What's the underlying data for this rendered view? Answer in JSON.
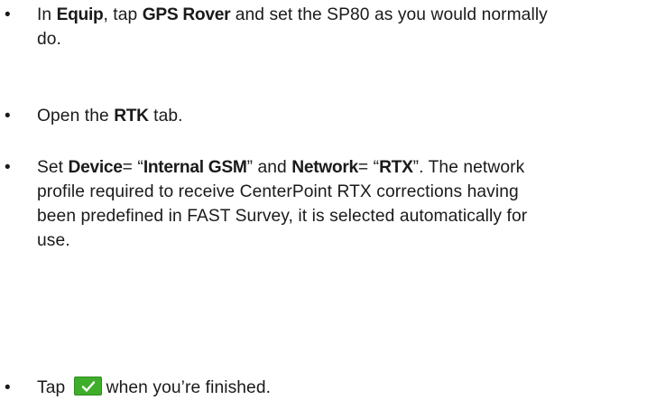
{
  "steps": [
    {
      "t1": "In ",
      "b1": "Equip",
      "t2": ", tap ",
      "b2": "GPS Rover",
      "t3": " and set the SP80 as you would normally",
      "t4": "do."
    },
    {
      "t1": "Open the ",
      "b1": "RTK",
      "t2": " tab."
    },
    {
      "t1": "Set ",
      "b1": "Device",
      "t2": "= “",
      "b2": "Internal GSM",
      "t3": "” and ",
      "b3": "Network",
      "t4": "= “",
      "b4": "RTX",
      "t5": "”. The network",
      "l2": "profile required to receive CenterPoint RTX corrections having",
      "l3": "been predefined in FAST Survey, it is selected automatically for",
      "l4": "use."
    },
    {
      "t1": "Tap ",
      "icon": "checkmark-confirm-icon",
      "t2": "when you’re finished."
    }
  ],
  "bullet": "•",
  "colors": {
    "text": "#1a1a1a",
    "check_button": "#3fae2a"
  }
}
